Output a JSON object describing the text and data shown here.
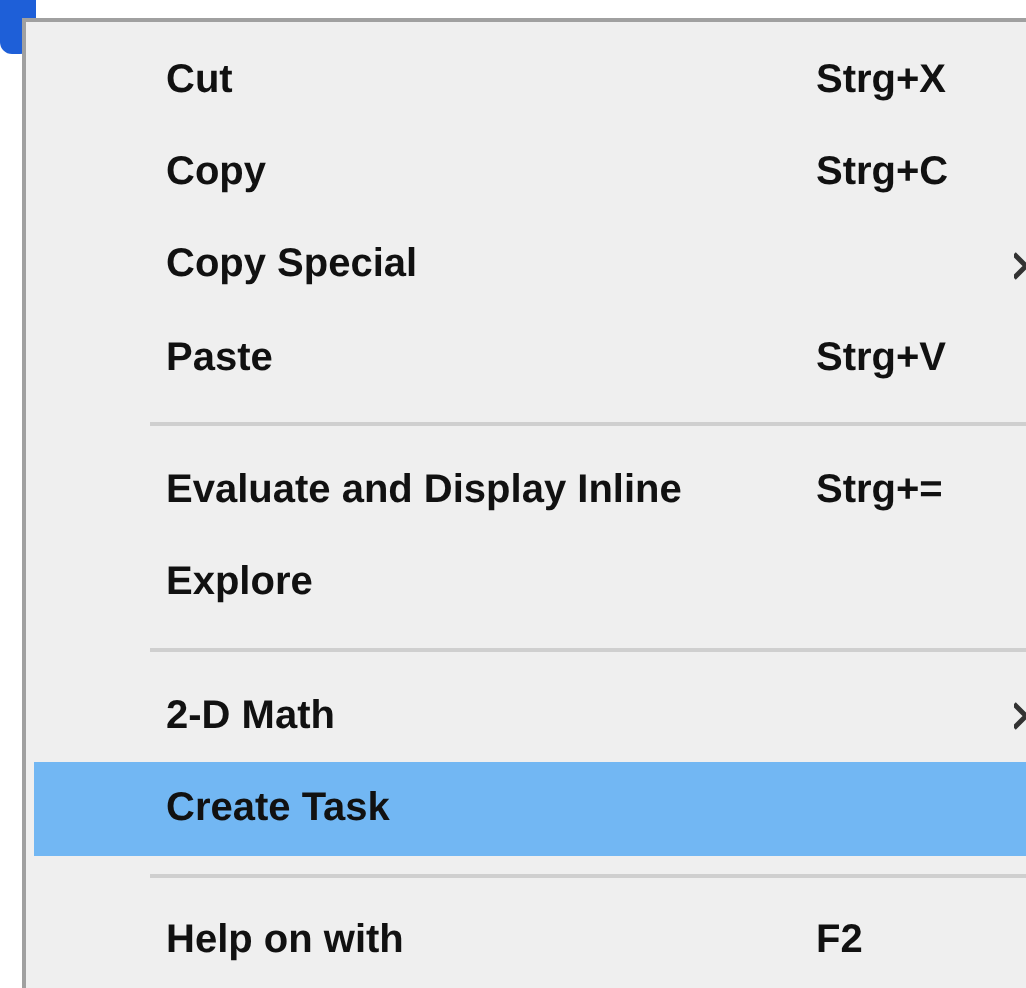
{
  "menu": {
    "items": [
      {
        "kind": "item",
        "label": "Cut",
        "shortcut": "Strg+X",
        "submenu": false,
        "selected": false
      },
      {
        "kind": "item",
        "label": "Copy",
        "shortcut": "Strg+C",
        "submenu": false,
        "selected": false
      },
      {
        "kind": "item",
        "label": "Copy Special",
        "submenu": true,
        "selected": false
      },
      {
        "kind": "item",
        "label": "Paste",
        "shortcut": "Strg+V",
        "submenu": false,
        "selected": false
      },
      {
        "kind": "separator"
      },
      {
        "kind": "item",
        "label": "Evaluate and Display Inline",
        "shortcut": "Strg+=",
        "submenu": false,
        "selected": false
      },
      {
        "kind": "item",
        "label": "Explore",
        "submenu": false,
        "selected": false
      },
      {
        "kind": "separator"
      },
      {
        "kind": "item",
        "label": "2-D Math",
        "submenu": true,
        "selected": false
      },
      {
        "kind": "item",
        "label": "Create Task",
        "submenu": false,
        "selected": true
      },
      {
        "kind": "separator"
      },
      {
        "kind": "item",
        "label": "Help on with",
        "shortcut": "F2",
        "submenu": false,
        "selected": false
      }
    ]
  }
}
